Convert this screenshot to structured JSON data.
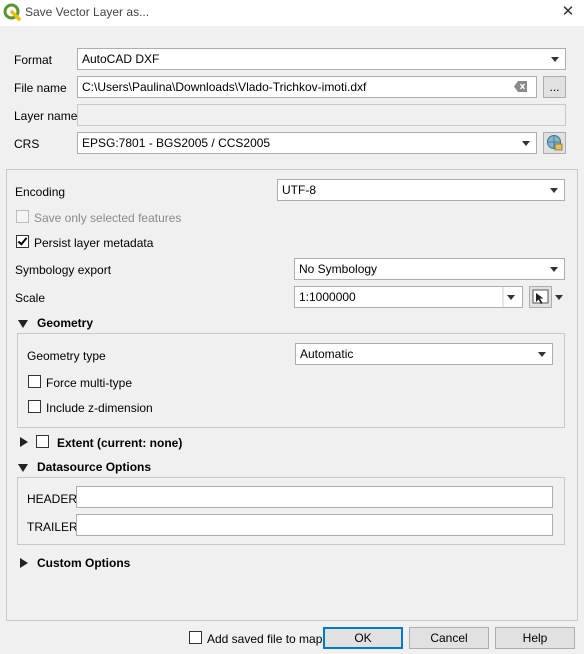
{
  "window": {
    "title": "Save Vector Layer as...",
    "close": "✕"
  },
  "general": {
    "format_label": "Format",
    "format_value": "AutoCAD DXF",
    "filename_label": "File name",
    "filename_value": "C:\\Users\\Paulina\\Downloads\\Vlado-Trichkov-imoti.dxf",
    "browse_label": "...",
    "layername_label": "Layer name",
    "layername_value": "",
    "crs_label": "CRS",
    "crs_value": "EPSG:7801 - BGS2005 / CCS2005"
  },
  "options": {
    "encoding_label": "Encoding",
    "encoding_value": "UTF-8",
    "save_selected_label": "Save only selected features",
    "save_selected_checked": false,
    "persist_metadata_label": "Persist layer metadata",
    "persist_metadata_checked": true,
    "symbology_label": "Symbology export",
    "symbology_value": "No Symbology",
    "scale_label": "Scale",
    "scale_value": "1:1000000"
  },
  "geometry": {
    "title": "Geometry",
    "type_label": "Geometry type",
    "type_value": "Automatic",
    "force_multi_label": "Force multi-type",
    "force_multi_checked": false,
    "include_z_label": "Include z-dimension",
    "include_z_checked": false
  },
  "extent": {
    "title": "Extent (current: none)",
    "checked": false
  },
  "datasource": {
    "title": "Datasource Options",
    "header_label": "HEADER",
    "header_value": "",
    "trailer_label": "TRAILER",
    "trailer_value": ""
  },
  "custom": {
    "title": "Custom Options"
  },
  "footer": {
    "add_to_map_label": "Add saved file to map",
    "add_to_map_checked": false,
    "ok_label": "OK",
    "cancel_label": "Cancel",
    "help_label": "Help"
  }
}
